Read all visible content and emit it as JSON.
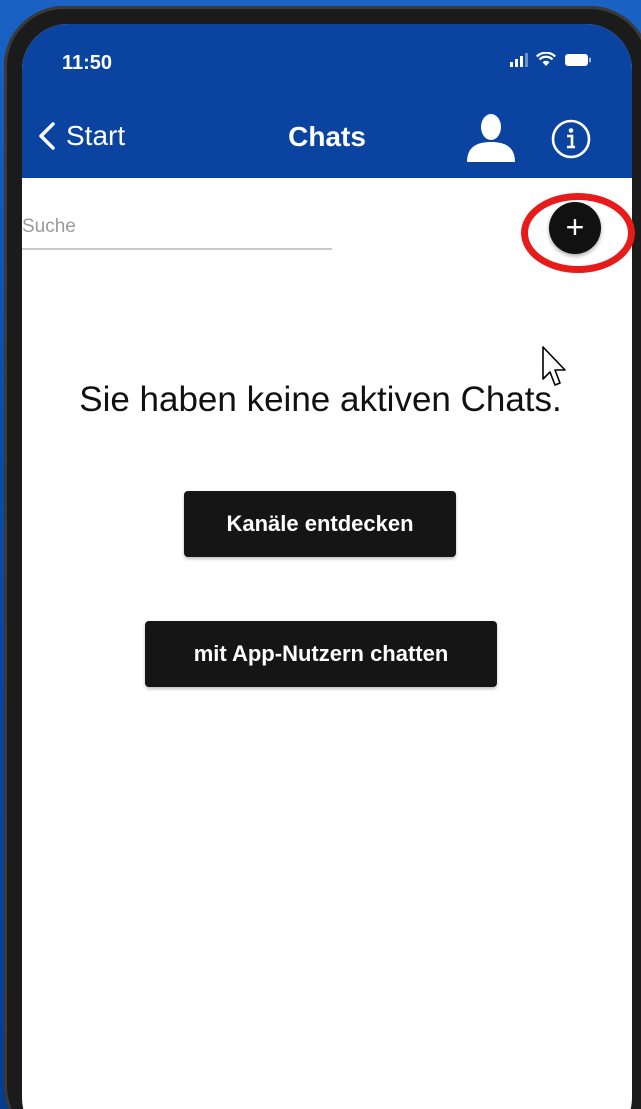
{
  "status_bar": {
    "time": "11:50",
    "signal_icon": "signal-icon",
    "wifi_icon": "wifi-icon",
    "battery_icon": "battery-icon"
  },
  "nav": {
    "back_label": "Start",
    "title": "Chats",
    "profile_icon": "person-icon",
    "info_icon": "info-icon"
  },
  "search": {
    "placeholder": "Suche",
    "value": ""
  },
  "add_button": {
    "label": "+",
    "icon": "plus-icon"
  },
  "empty_state": {
    "message": "Sie haben keine aktiven Chats."
  },
  "actions": {
    "discover_channels": "Kanäle entdecken",
    "chat_with_users": "mit App-Nutzern chatten"
  },
  "colors": {
    "header": "#0a44a0",
    "background": "#1a63c4",
    "button": "#151515",
    "highlight": "#e81b1b"
  }
}
